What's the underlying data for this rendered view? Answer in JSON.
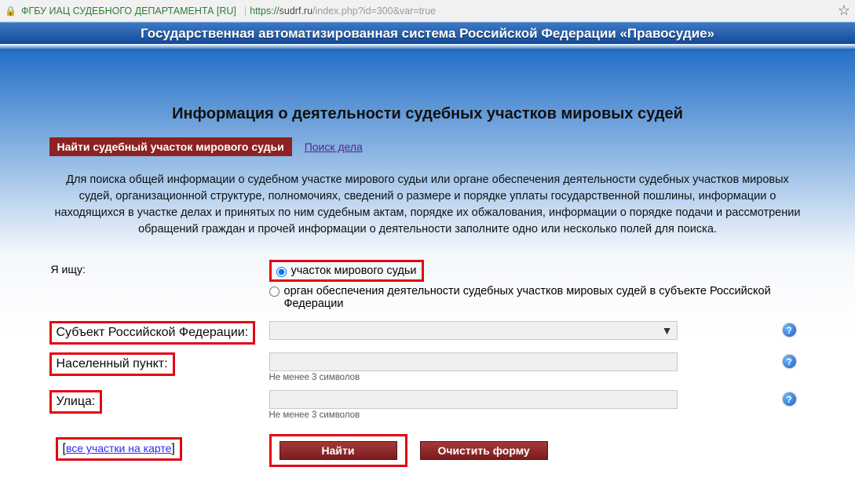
{
  "browser": {
    "ev_label": "ФГБУ ИАЦ СУДЕБНОГО ДЕПАРТАМЕНТА [RU]",
    "url_https": "https://",
    "url_host": "sudrf.ru",
    "url_rest": "/index.php?id=300&var=true"
  },
  "header": {
    "title": "Государственная автоматизированная система Российской Федерации «Правосудие»"
  },
  "page": {
    "title": "Информация о деятельности судебных участков мировых судей"
  },
  "tabs": {
    "active": "Найти судебный участок мирового судьи",
    "link": "Поиск дела"
  },
  "intro": "Для поиска общей информации о судебном участке мирового судьи или органе обеспечения деятельности судебных участков мировых судей, организационной структуре, полномочиях, сведений о размере и порядке уплаты государственной пошлины, информации о находящихся в участке делах и принятых по ним судебным актам, порядке их обжалования, информации о порядке подачи и рассмотрении обращений граждан и прочей информации о деятельности заполните одно или несколько полей для поиска.",
  "form": {
    "search_kind_label": "Я ищу:",
    "radio1": "участок мирового судьи",
    "radio2": "орган обеспечения деятельности судебных участков мировых судей в субъекте Российской Федерации",
    "subject_label": "Субъект Российской Федерации:",
    "subject_value": "",
    "city_label": "Населенный пункт:",
    "city_value": "",
    "city_hint": "Не менее 3 символов",
    "street_label": "Улица:",
    "street_value": "",
    "street_hint": "Не менее 3 символов",
    "help_glyph": "?",
    "map_link": "все участки на карте",
    "btn_find": "Найти",
    "btn_clear": "Очистить форму"
  }
}
